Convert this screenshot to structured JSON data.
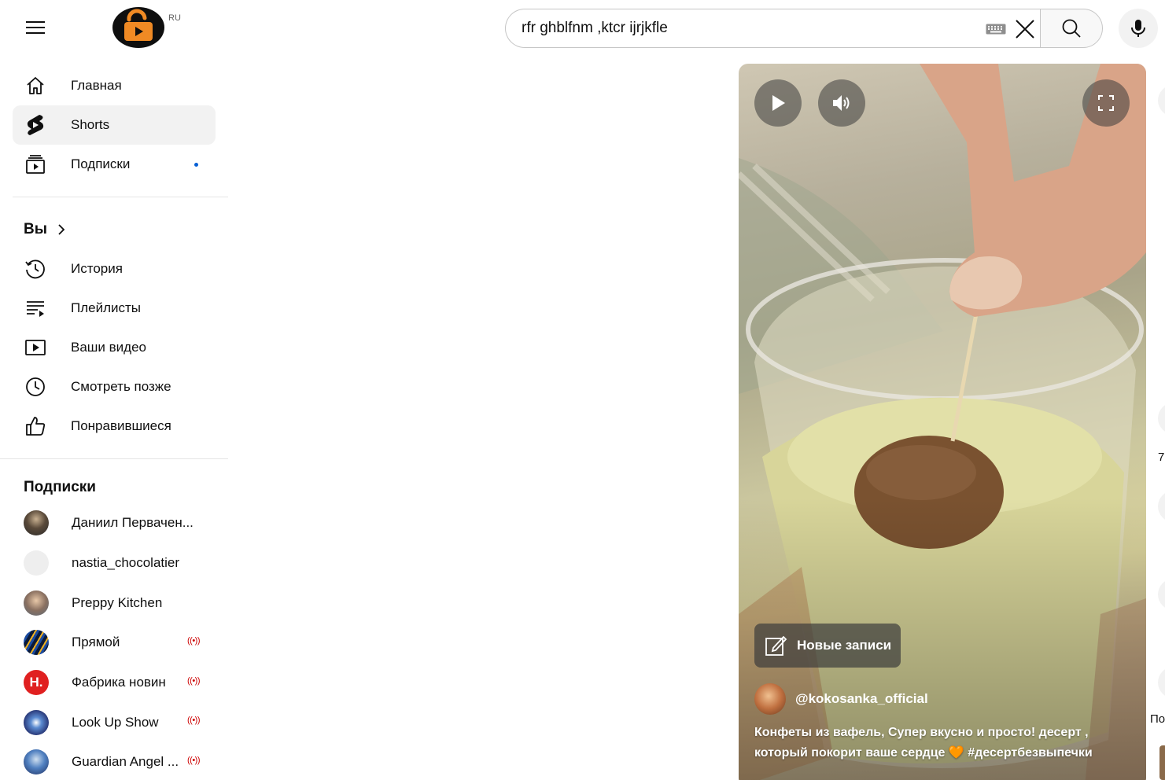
{
  "header": {
    "logo_region": "RU",
    "search_value": "rfr ghblfnm ,ktcr ijrjkfle"
  },
  "sidebar": {
    "primary": [
      {
        "label": "Главная",
        "icon": "home-icon"
      },
      {
        "label": "Shorts",
        "icon": "shorts-icon",
        "active": true
      },
      {
        "label": "Подписки",
        "icon": "subscriptions-icon",
        "new_dot": true
      }
    ],
    "you_label": "Вы",
    "you_items": [
      {
        "label": "История",
        "icon": "history-icon"
      },
      {
        "label": "Плейлисты",
        "icon": "playlists-icon"
      },
      {
        "label": "Ваши видео",
        "icon": "your-videos-icon"
      },
      {
        "label": "Смотреть позже",
        "icon": "watch-later-icon"
      },
      {
        "label": "Понравившиеся",
        "icon": "liked-icon"
      }
    ],
    "subscriptions_title": "Подписки",
    "subscriptions": [
      {
        "name": "Даниил Первачен...",
        "live": ""
      },
      {
        "name": "nastia_chocolatier",
        "live": ""
      },
      {
        "name": "Preppy Kitchen",
        "live": ""
      },
      {
        "name": "Прямой",
        "live": "((•))"
      },
      {
        "name": "Фабрика новин",
        "live": "((•))"
      },
      {
        "name": "Look Up Show",
        "live": "((•))"
      },
      {
        "name": "Guardian Angel ...",
        "live": "((•))"
      }
    ]
  },
  "short": {
    "new_posts_label": "Новые записи",
    "channel": "@kokosanka_official",
    "description_line1": "Конфеты из вафель, Супер вкусно и просто! десерт ,",
    "description_line2": "который покорит ваше сердце",
    "heart": "🧡",
    "hashtag": "#десертбезвыпечки"
  },
  "edge": {
    "text1": "7",
    "text2": "По"
  },
  "colors": {
    "logo_orange": "#f08a24",
    "accent_blue": "#065fd4",
    "live_red": "#cc0000",
    "active_bg": "#f2f2f2"
  }
}
